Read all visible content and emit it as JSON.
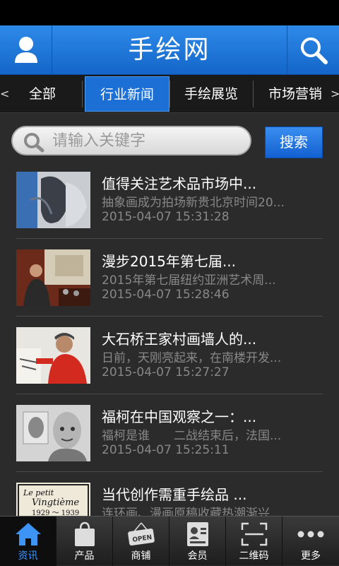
{
  "header": {
    "title": "手绘网",
    "user_icon": "user-icon",
    "search_icon": "search-icon"
  },
  "tabs": {
    "left_arrow": "<",
    "right_arrow": ">",
    "items": [
      {
        "label": "全部",
        "active": false
      },
      {
        "label": "行业新闻",
        "active": true
      },
      {
        "label": "手绘展览",
        "active": false
      },
      {
        "label": "市场营销",
        "active": false
      }
    ]
  },
  "search": {
    "placeholder": "请输入关键字",
    "value": "",
    "button_label": "搜索"
  },
  "news": [
    {
      "title": "值得关注艺术品市场中...",
      "summary": "抽象画成为拍场新贵北京时间20...",
      "date": "2015-04-07 15:31:28"
    },
    {
      "title": "漫步2015年第七届...",
      "summary": "2015年第七届纽约亚洲艺术周...",
      "date": "2015-04-07 15:28:46"
    },
    {
      "title": "大石桥王家村画墙人的...",
      "summary": "日前，天刚亮起来，在南楼开发...",
      "date": "2015-04-07 15:27:27"
    },
    {
      "title": "福柯在中国观察之一：...",
      "summary": "福柯是谁　　二战结束后，法国...",
      "date": "2015-04-07 15:25:11"
    },
    {
      "title": "当代创作需重手绘品 ...",
      "summary": "连环画、漫画原稿收藏热潮渐兴...",
      "date": ""
    }
  ],
  "thumb5_text": [
    "Le petit",
    "Vingtième",
    "1929 ～ 1939"
  ],
  "bottom_nav": [
    {
      "label": "资讯",
      "icon": "home-icon",
      "active": true
    },
    {
      "label": "产品",
      "icon": "shopping-bag-icon",
      "active": false
    },
    {
      "label": "商铺",
      "icon": "open-sign-icon",
      "active": false,
      "sign_text": "OPEN"
    },
    {
      "label": "会员",
      "icon": "member-card-icon",
      "active": false
    },
    {
      "label": "二维码",
      "icon": "qr-scan-icon",
      "active": false
    },
    {
      "label": "更多",
      "icon": "more-dots-icon",
      "active": false
    }
  ],
  "colors": {
    "accent": "#1c6fd4",
    "background": "#2b2b2b",
    "nav_active": "#3d94f5"
  }
}
